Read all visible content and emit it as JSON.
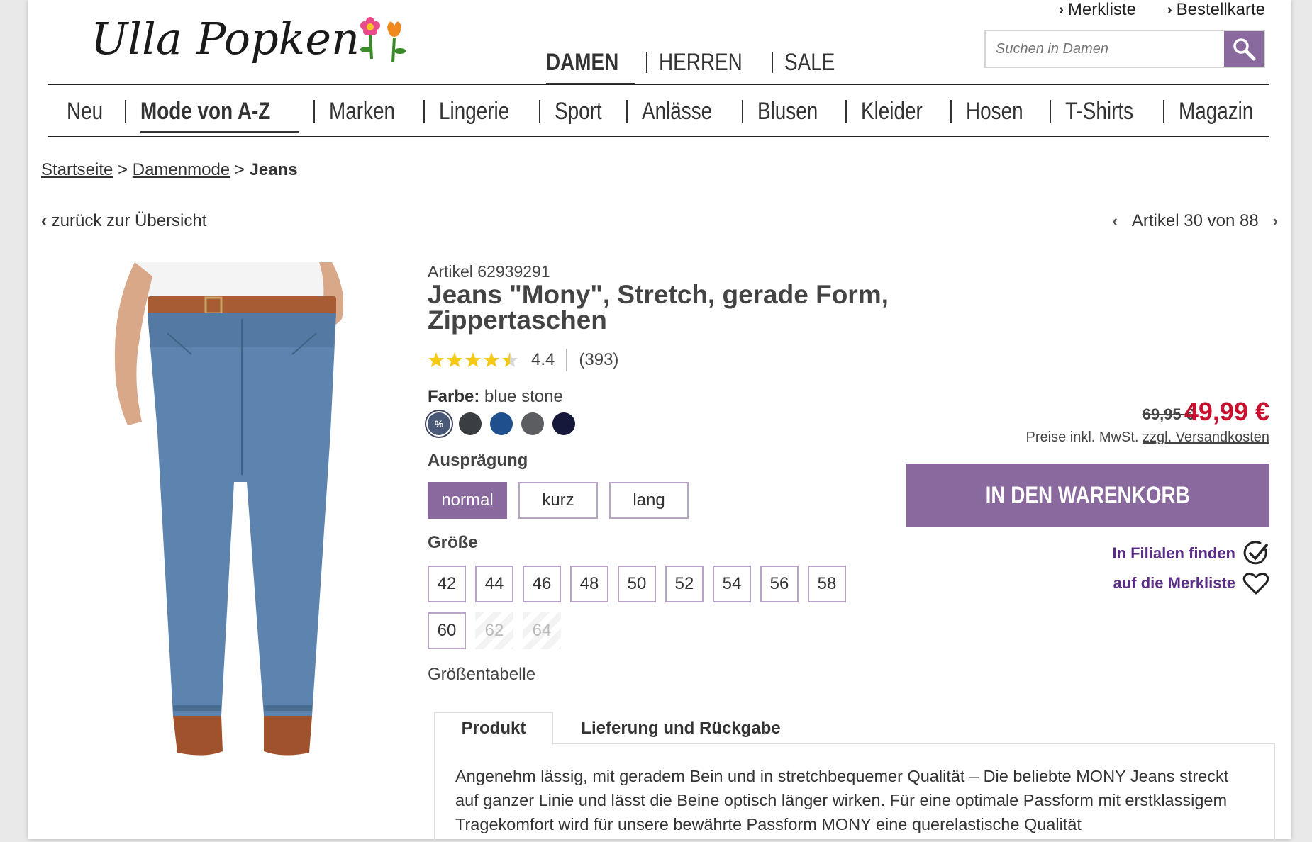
{
  "header": {
    "logo_text": "Ulla Popken",
    "top_links": [
      {
        "label": "Merkliste"
      },
      {
        "label": "Bestellkarte"
      }
    ],
    "gender_nav": [
      "DAMEN",
      "HERREN",
      "SALE"
    ],
    "search": {
      "placeholder": "Suchen in Damen"
    },
    "main_nav": [
      "Neu",
      "Mode von A-Z",
      "Marken",
      "Lingerie",
      "Sport",
      "Anlässe",
      "Blusen",
      "Kleider",
      "Hosen",
      "T-Shirts",
      "Magazin"
    ]
  },
  "breadcrumb": {
    "items": [
      "Startseite",
      "Damenmode"
    ],
    "separator": ">",
    "current": "Jeans"
  },
  "navigation": {
    "back": "zurück zur Übersicht",
    "position": "Artikel 30 von 88"
  },
  "product": {
    "article_number": "Artikel 62939291",
    "title": "Jeans \"Mony\", Stretch, gerade Form, Zippertaschen",
    "rating": {
      "value": "4.4",
      "count": "(393)",
      "stars": 4.4
    },
    "color": {
      "label": "Farbe:",
      "value": "blue stone"
    },
    "swatches": [
      {
        "name": "blue stone",
        "color": "#4a5878",
        "sale_mark": "%"
      },
      {
        "name": "anthracite",
        "color": "#3a3d41"
      },
      {
        "name": "blue",
        "color": "#1f4f8c"
      },
      {
        "name": "grey",
        "color": "#5b5d60"
      },
      {
        "name": "navy",
        "color": "#15183a"
      }
    ],
    "variant_label": "Ausprägung",
    "variants": [
      "normal",
      "kurz",
      "lang"
    ],
    "size_label": "Größe",
    "sizes": [
      {
        "label": "42",
        "available": true
      },
      {
        "label": "44",
        "available": true
      },
      {
        "label": "46",
        "available": true
      },
      {
        "label": "48",
        "available": true
      },
      {
        "label": "50",
        "available": true
      },
      {
        "label": "52",
        "available": true
      },
      {
        "label": "54",
        "available": true
      },
      {
        "label": "56",
        "available": true
      },
      {
        "label": "58",
        "available": true
      },
      {
        "label": "60",
        "available": true
      },
      {
        "label": "62",
        "available": false
      },
      {
        "label": "64",
        "available": false
      }
    ],
    "size_table": "Größentabelle"
  },
  "buy_box": {
    "old_price": "69,95 €",
    "new_price": "49,99 €",
    "vat_note": "Preise inkl. MwSt.",
    "shipping_link": "zzgl. Versandkosten",
    "cart_button": "IN DEN WARENKORB",
    "store_link": "In Filialen finden",
    "wishlist_link": "auf die Merkliste"
  },
  "tabs": {
    "items": [
      "Produkt",
      "Lieferung und Rückgabe"
    ],
    "active": "Produkt",
    "body": "Angenehm lässig, mit geradem Bein und in stretchbequemer Qualität – Die beliebte MONY Jeans streckt auf ganzer Linie und lässt die Beine optisch länger wirken. Für eine optimale Passform mit erstklassigem Tragekomfort wird für unsere bewährte Passform MONY eine querelastische Qualität"
  },
  "colors": {
    "accent": "#8a6a9e",
    "price_red": "#c8102e",
    "link_purple": "#5a2d86"
  }
}
